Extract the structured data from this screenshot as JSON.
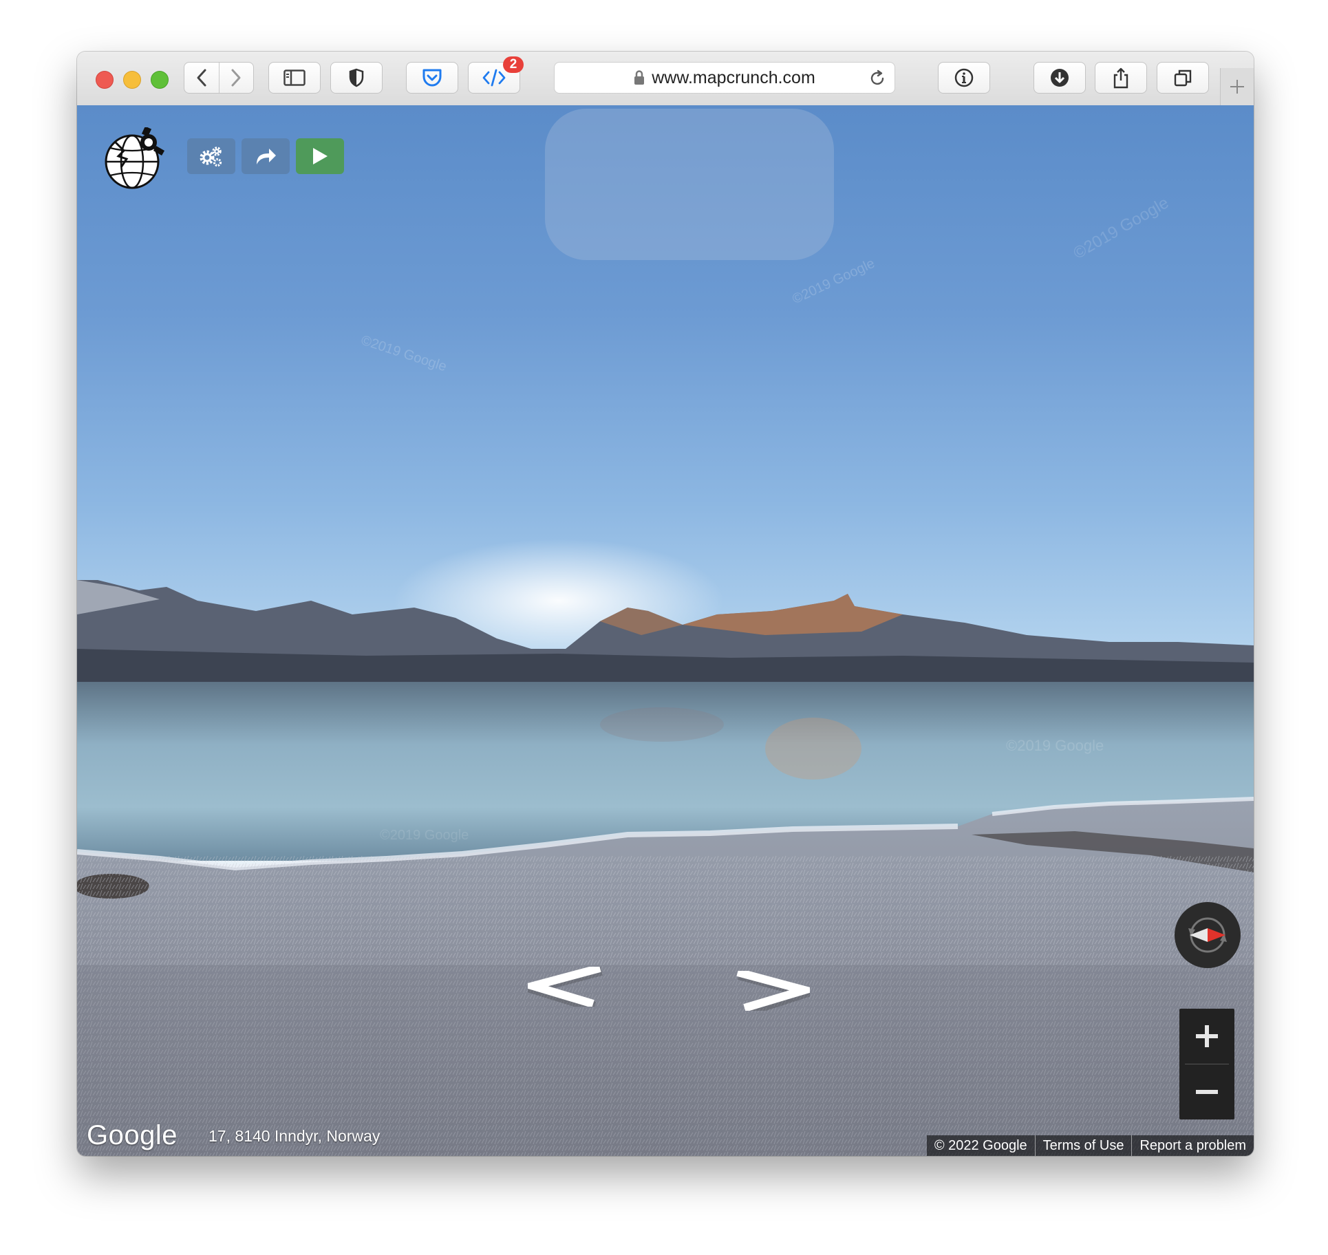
{
  "browser": {
    "url": "www.mapcrunch.com",
    "devtools_badge": "2",
    "colors": {
      "close": "#ee5a52",
      "minimize": "#f6be3b",
      "zoom": "#5fc038",
      "accent": "#1f7bef"
    },
    "icons": [
      "back-icon",
      "forward-icon",
      "sidebar-icon",
      "shield-icon",
      "pocket-icon",
      "code-icon",
      "lock-icon",
      "reload-icon",
      "info-icon",
      "download-icon",
      "share-icon",
      "tabs-icon",
      "plus-icon"
    ]
  },
  "app": {
    "controls": {
      "settings_icon": "gear-icon",
      "share_icon": "share-arrow-icon",
      "go_icon": "play-icon",
      "colors": {
        "blue_button": "#5b82b0",
        "green_button": "#4f9a5a"
      }
    },
    "streetview": {
      "address": "17, 8140 Inndyr, Norway",
      "google_logo": "Google",
      "footer": {
        "copyright": "© 2022 Google",
        "terms": "Terms of Use",
        "report": "Report a problem"
      },
      "zoom_in": "+",
      "zoom_out": "−",
      "watermarks": [
        "©2019 Google",
        "©2019 Google",
        "©2019 Google",
        "©2019 Google",
        "©2019 Google"
      ]
    }
  }
}
